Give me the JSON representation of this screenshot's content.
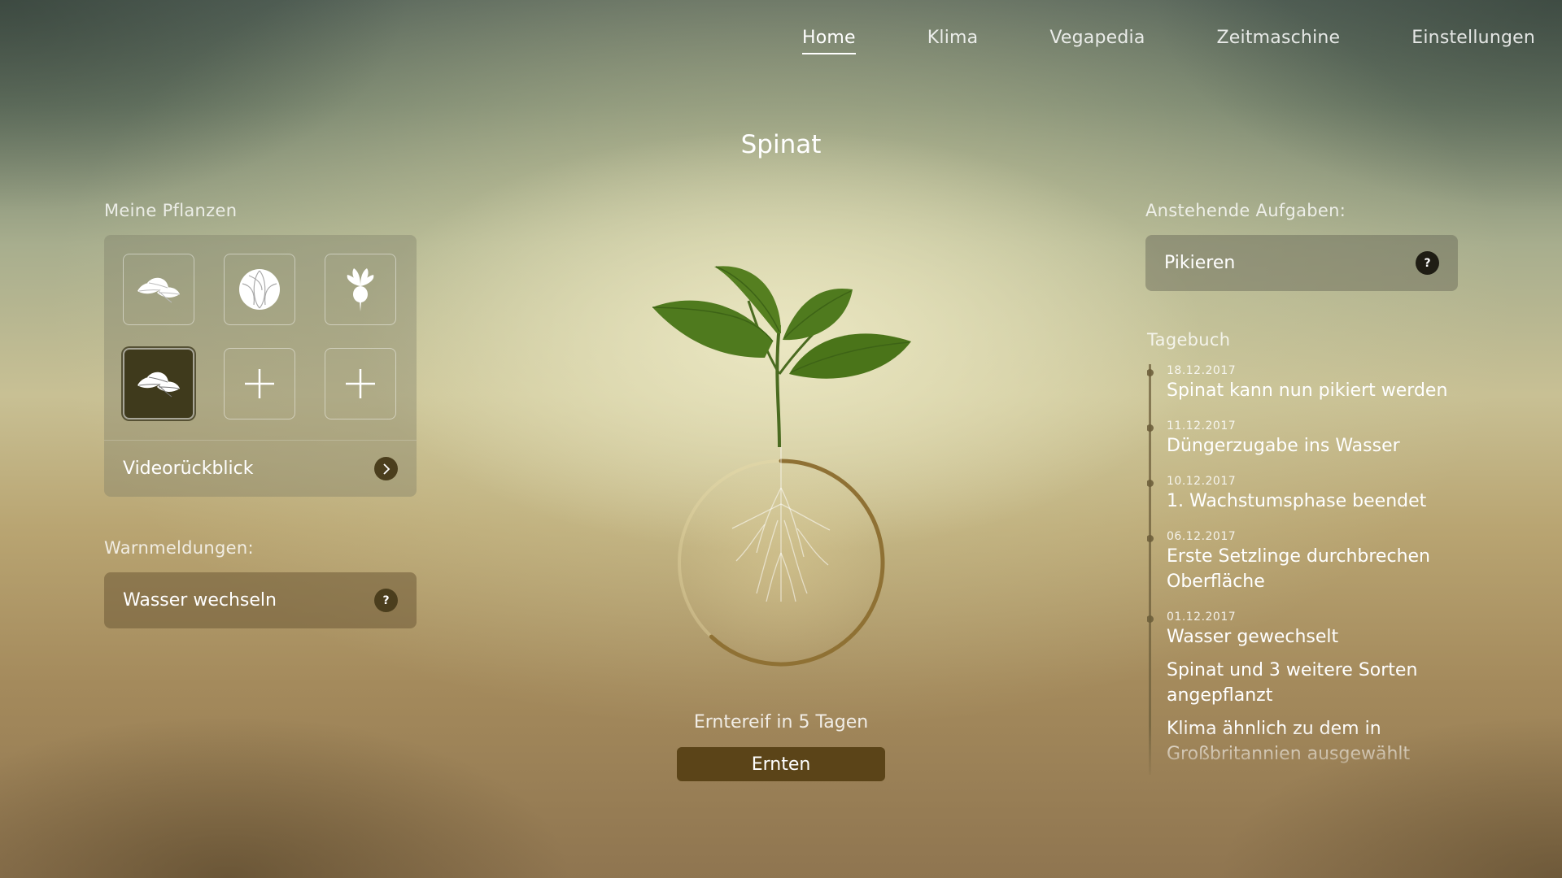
{
  "nav": {
    "items": [
      {
        "label": "Home",
        "active": true
      },
      {
        "label": "Klima"
      },
      {
        "label": "Vegapedia"
      },
      {
        "label": "Zeitmaschine"
      },
      {
        "label": "Einstellungen"
      }
    ]
  },
  "title": "Spinat",
  "plants": {
    "label": "Meine Pflanzen",
    "tiles": [
      {
        "icon": "spinach-icon"
      },
      {
        "icon": "cabbage-icon"
      },
      {
        "icon": "radish-icon"
      },
      {
        "icon": "spinach-icon",
        "selected": true
      },
      {
        "icon": "plus-icon"
      },
      {
        "icon": "plus-icon"
      }
    ],
    "video_label": "Videorückblick"
  },
  "warnings": {
    "label": "Warnmeldungen:",
    "item": "Wasser wechseln",
    "help": "?"
  },
  "center": {
    "harvest_text": "Erntereif in 5 Tagen",
    "harvest_button": "Ernten",
    "growth_progress": 0.62
  },
  "tasks": {
    "label": "Anstehende Aufgaben:",
    "item": "Pikieren",
    "help": "?"
  },
  "diary": {
    "label": "Tagebuch",
    "entries": [
      {
        "date": "18.12.2017",
        "text": "Spinat kann nun pikiert werden"
      },
      {
        "date": "11.12.2017",
        "text": "Düngerzugabe ins Wasser"
      },
      {
        "date": "10.12.2017",
        "text": "1. Wachstumsphase beendet"
      },
      {
        "date": "06.12.2017",
        "text": "Erste Setzlinge durchbrechen Oberfläche"
      },
      {
        "date": "01.12.2017",
        "text": "Wasser gewechselt"
      },
      {
        "date": "",
        "text": "Spinat und 3 weitere Sorten angepflanzt"
      },
      {
        "date": "",
        "text": "Klima ähnlich zu dem in Großbritannien ausgewählt"
      }
    ]
  },
  "colors": {
    "leaf": "#4f7a1e",
    "leaf_dark": "#3d6316",
    "button": "#5b4418",
    "selected_tile": "#3f3a1c"
  }
}
